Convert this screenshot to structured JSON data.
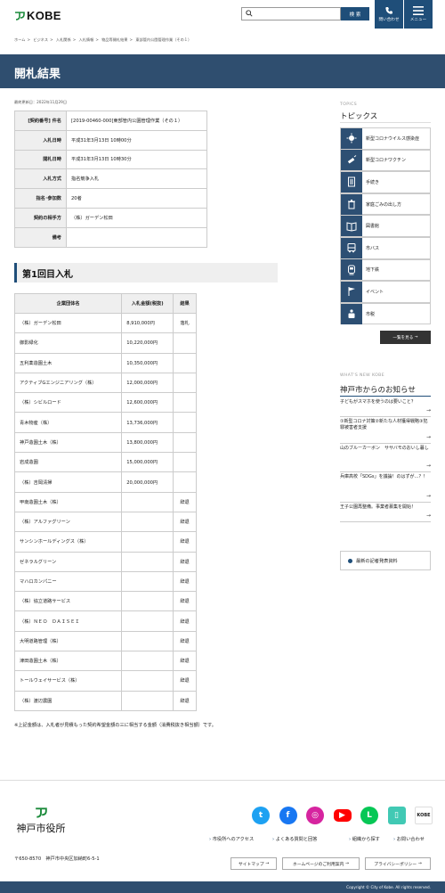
{
  "header": {
    "logo_text": "KOBE",
    "search_button": "検 索",
    "contact_label": "問い合わせ",
    "menu_label": "メニュー"
  },
  "breadcrumb": [
    "ホーム",
    "ビジネス",
    "入札関係",
    "入札情報",
    "物品等開札結果",
    "東部管内公園管理作業（その１）"
  ],
  "page": {
    "title": "開札結果",
    "updated": "最終更新日：2022年11月29日"
  },
  "info_table": [
    {
      "label": "[契約番号] 件名",
      "value": "[2019-00460-000]東部管内公園管理作業（その１）"
    },
    {
      "label": "入札日時",
      "value": "平成31年3月13日 10時00分"
    },
    {
      "label": "開札日時",
      "value": "平成31年3月13日 10時30分"
    },
    {
      "label": "入札方式",
      "value": "指名競争入札"
    },
    {
      "label": "指名･参加数",
      "value": "20者"
    },
    {
      "label": "契約の相手方",
      "value": "（株）ガーデン松田"
    },
    {
      "label": "備考",
      "value": ""
    }
  ],
  "section": {
    "title": "第1回目入札"
  },
  "bid_table": {
    "headers": [
      "企業団体名",
      "入札金額(税抜)",
      "結果"
    ],
    "rows": [
      [
        "（株）ガーデン松田",
        "8,910,000円",
        "落札"
      ],
      [
        "御影緑化",
        "10,220,000円",
        ""
      ],
      [
        "五利薬造園土木",
        "10,350,000円",
        ""
      ],
      [
        "アクティブGエンジニアリング（株）",
        "12,000,000円",
        ""
      ],
      [
        "（株）シビルロード",
        "12,600,000円",
        ""
      ],
      [
        "青木物産（株）",
        "13,736,000円",
        ""
      ],
      [
        "神戸造園土木（株）",
        "13,800,000円",
        ""
      ],
      [
        "岩成造園",
        "15,000,000円",
        ""
      ],
      [
        "（株）吉岡清掃",
        "20,000,000円",
        ""
      ],
      [
        "甲南造園土木（株）",
        "",
        "辞退"
      ],
      [
        "（株）アルファグリーン",
        "",
        "辞退"
      ],
      [
        "サンシンホールディングス（株）",
        "",
        "辞退"
      ],
      [
        "ゼネラルグリーン",
        "",
        "辞退"
      ],
      [
        "マハロカンパニー",
        "",
        "辞退"
      ],
      [
        "（株）協立道路サービス",
        "",
        "辞退"
      ],
      [
        "（株）ＮＥＯ　ＤＡＩＳＥＩ",
        "",
        "辞退"
      ],
      [
        "大明道路管理（株）",
        "",
        "辞退"
      ],
      [
        "津田造園土木（株）",
        "",
        "辞退"
      ],
      [
        "トールウェイサービス（株）",
        "",
        "辞退"
      ],
      [
        "（株）渡辺農園",
        "",
        "辞退"
      ]
    ]
  },
  "footnote": "※上記金額は、入札者が見積もった契約希望金額の三に相当する金額（消費税抜き相当額）です。",
  "sidebar": {
    "topics_en": "TOPICS",
    "topics_jp": "トピックス",
    "topics": [
      {
        "label": "新型コロナウイルス感染症",
        "icon": "virus-icon"
      },
      {
        "label": "新型コロナワクチン",
        "icon": "syringe-icon"
      },
      {
        "label": "手続き",
        "icon": "document-icon"
      },
      {
        "label": "家庭ごみの出し方",
        "icon": "trash-icon"
      },
      {
        "label": "図書館",
        "icon": "book-icon"
      },
      {
        "label": "市バス",
        "icon": "bus-icon"
      },
      {
        "label": "地下鉄",
        "icon": "train-icon"
      },
      {
        "label": "イベント",
        "icon": "flag-icon"
      },
      {
        "label": "市税",
        "icon": "tax-icon"
      }
    ],
    "more_topics": "一覧を見る",
    "news_en": "WHAT'S NEW KOBE",
    "news_jp": "神戸市からのお知らせ",
    "news": [
      "子どもがスマホを使うのは要いこと？",
      "①新型コロナ対策②新たな人材獲得戦略③犯罪被害者支援",
      "山のブルーカーボン　ササバモのおいし暮し",
      "兵庫高校「SDGs」を議論！のはずが…？！",
      "王子公園再整備。事業者募集を開始！"
    ],
    "press": "最新の記者発表資料"
  },
  "footer": {
    "city_name": "神戸市役所",
    "address": "〒650-8570　神戸市中央区加納町6-5-1",
    "links": [
      "市役所へのアクセス",
      "よくある質問と回答",
      "組織から探す",
      "お問い合わせ"
    ],
    "buttons": [
      "サイトマップ",
      "ホームページのご利用案内",
      "プライバシーポリシー"
    ],
    "copyright": "Copyright © City of Kobe. All rights reserved.",
    "sns": [
      {
        "name": "twitter",
        "color": "#1da1f2",
        "glyph": "t"
      },
      {
        "name": "facebook",
        "color": "#1877f2",
        "glyph": "f"
      },
      {
        "name": "instagram",
        "color": "#d6249f",
        "glyph": "◎"
      },
      {
        "name": "youtube",
        "color": "#ff0000",
        "glyph": "▶"
      },
      {
        "name": "line",
        "color": "#06c755",
        "glyph": "L"
      },
      {
        "name": "note",
        "color": "#41c9b4",
        "glyph": "▯"
      }
    ]
  },
  "colors": {
    "brand": "#1f4e79",
    "title_band": "#2f4e6f"
  }
}
